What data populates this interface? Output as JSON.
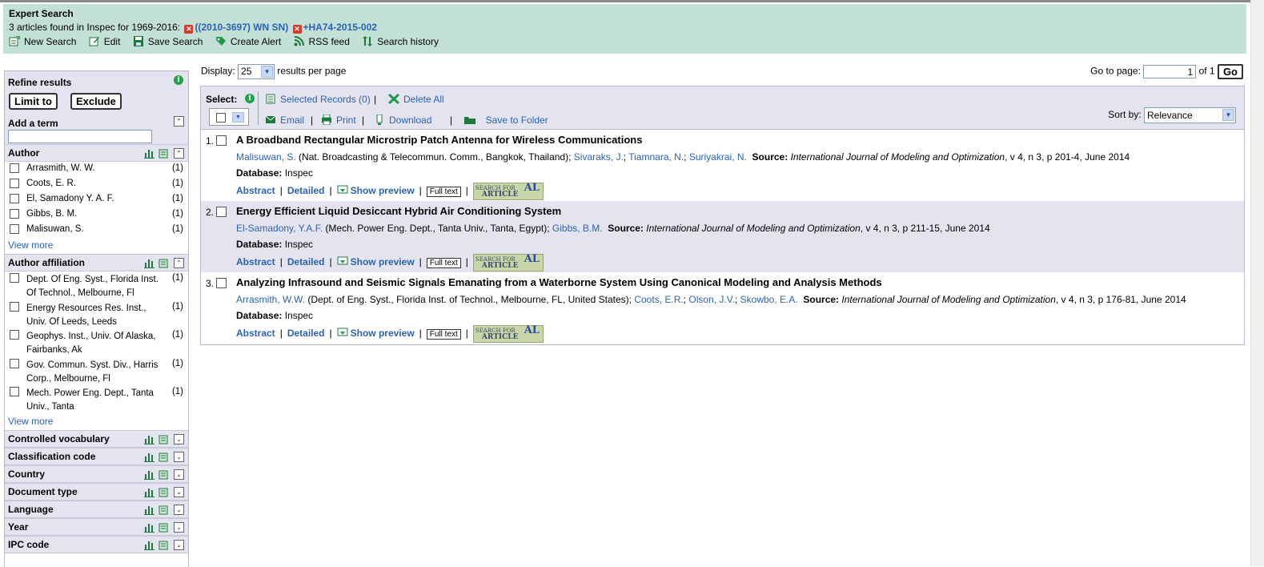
{
  "header": {
    "title": "Expert Search",
    "found_prefix": "3 articles found in Inspec for 1969-2016:",
    "query1": "((2010-3697) WN SN)",
    "query2": "+HA74-2015-002",
    "toolbar": {
      "new_search": "New Search",
      "edit": "Edit",
      "save_search": "Save Search",
      "create_alert": "Create Alert",
      "rss_feed": "RSS feed",
      "search_history": "Search history"
    }
  },
  "sidebar": {
    "refine_label": "Refine results",
    "limit_to": "Limit to",
    "exclude": "Exclude",
    "add_term_label": "Add a term",
    "author": {
      "label": "Author",
      "items": [
        {
          "name": "Arrasmith, W. W.",
          "count": "(1)"
        },
        {
          "name": "Coots, E. R.",
          "count": "(1)"
        },
        {
          "name": "El, Samadony Y. A. F.",
          "count": "(1)"
        },
        {
          "name": "Gibbs, B. M.",
          "count": "(1)"
        },
        {
          "name": "Malisuwan, S.",
          "count": "(1)"
        }
      ],
      "view_more": "View more"
    },
    "affiliation": {
      "label": "Author affiliation",
      "items": [
        {
          "name": "Dept. Of Eng. Syst., Florida Inst. Of Technol., Melbourne, Fl",
          "count": "(1)"
        },
        {
          "name": "Energy Resources Res. Inst., Univ. Of Leeds, Leeds",
          "count": "(1)"
        },
        {
          "name": "Geophys. Inst., Univ. Of Alaska, Fairbanks, Ak",
          "count": "(1)"
        },
        {
          "name": "Gov. Commun. Syst. Div., Harris Corp., Melbourne, Fl",
          "count": "(1)"
        },
        {
          "name": "Mech. Power Eng. Dept., Tanta Univ., Tanta",
          "count": "(1)"
        }
      ],
      "view_more": "View more"
    },
    "collapsed": [
      "Controlled vocabulary",
      "Classification code",
      "Country",
      "Document type",
      "Language",
      "Year",
      "IPC code"
    ]
  },
  "main": {
    "display_label": "Display:",
    "display_value": "25",
    "display_suffix": "results per page",
    "goto_label": "Go to page:",
    "goto_value": "1",
    "goto_of": "of 1",
    "go_button": "Go",
    "select_label": "Select:",
    "selected_records": "Selected Records (0)",
    "delete_all": "Delete All",
    "email": "Email",
    "print": "Print",
    "download": "Download",
    "save_to_folder": "Save to Folder",
    "sort_label": "Sort by:",
    "sort_value": "Relevance"
  },
  "results": [
    {
      "num": "1.",
      "title": "A Broadband Rectangular Microstrip Patch Antenna for Wireless Communications",
      "first_author": "Malisuwan, S.",
      "affil": "(Nat. Broadcasting & Telecommun. Comm., Bangkok, Thailand);",
      "other_authors": [
        "Sivaraks, J.",
        "Tiamnara, N.",
        "Suriyakrai, N."
      ],
      "source_journal": "International Journal of Modeling and Optimization",
      "source_rest": ", v 4, n 3, p 201-4, June 2014",
      "database": "Inspec"
    },
    {
      "num": "2.",
      "title": "Energy Efficient Liquid Desiccant Hybrid Air Conditioning System",
      "first_author": "El-Samadony, Y.A.F.",
      "affil": "(Mech. Power Eng. Dept., Tanta Univ., Tanta, Egypt);",
      "other_authors": [
        "Gibbs, B.M."
      ],
      "source_journal": "International Journal of Modeling and Optimization",
      "source_rest": ", v 4, n 3, p 211-15, June 2014",
      "database": "Inspec"
    },
    {
      "num": "3.",
      "title": "Analyzing Infrasound and Seismic Signals Emanating from a Waterborne System Using Canonical Modeling and Analysis Methods",
      "first_author": "Arrasmith, W.W.",
      "affil": "(Dept. of Eng. Syst., Florida Inst. of Technol., Melbourne, FL, United States);",
      "other_authors": [
        "Coots, E.R.",
        "Olson, J.V.",
        "Skowbo, E.A."
      ],
      "source_journal": "International Journal of Modeling and Optimization",
      "source_rest": ", v 4, n 3, p 176-81, June 2014",
      "database": "Inspec"
    }
  ],
  "result_labels": {
    "source": "Source:",
    "database": "Database:",
    "abstract": "Abstract",
    "detailed": "Detailed",
    "show_preview": "Show preview",
    "full_text": "Full text",
    "sfa_line1": "SEARCH FOR",
    "sfa_line2": "ARTICLE",
    "sfa_logo": "AL"
  }
}
